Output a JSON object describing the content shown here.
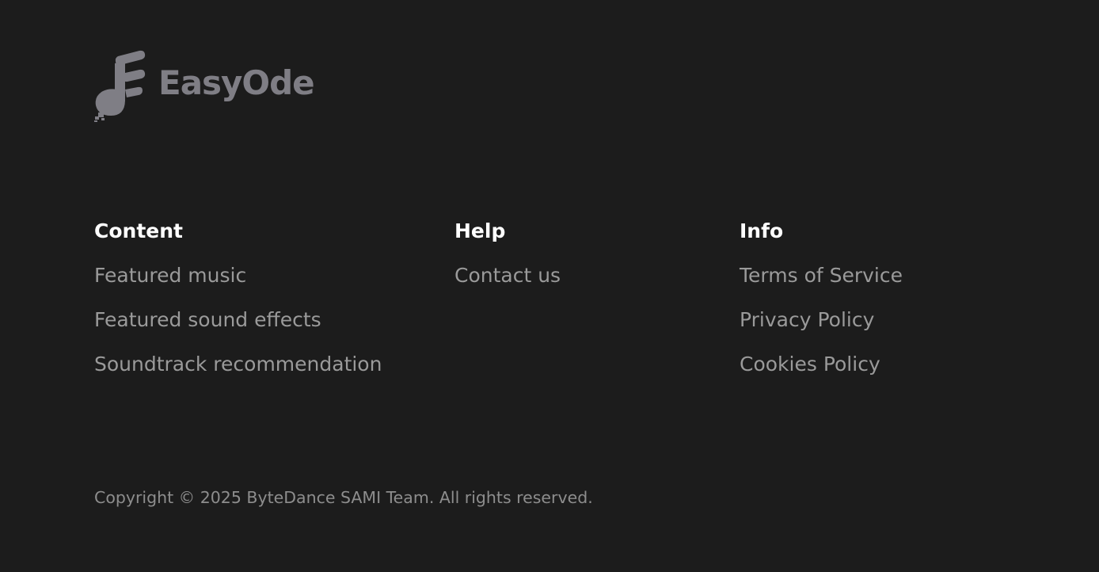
{
  "brand": {
    "name": "EasyOde",
    "logo_icon": "music-note-logo-icon",
    "logo_color": "#7f7e85"
  },
  "colors": {
    "background": "#1c1c1c",
    "heading": "#ffffff",
    "link": "#9a9a9a",
    "copyright": "#8d8d8d"
  },
  "columns": {
    "content": {
      "heading": "Content",
      "links": [
        "Featured music",
        "Featured sound effects",
        "Soundtrack recommendation"
      ]
    },
    "help": {
      "heading": "Help",
      "links": [
        "Contact us"
      ]
    },
    "info": {
      "heading": "Info",
      "links": [
        "Terms of Service",
        "Privacy Policy",
        "Cookies Policy"
      ]
    }
  },
  "copyright": "Copyright © 2025 ByteDance SAMI Team. All rights reserved."
}
